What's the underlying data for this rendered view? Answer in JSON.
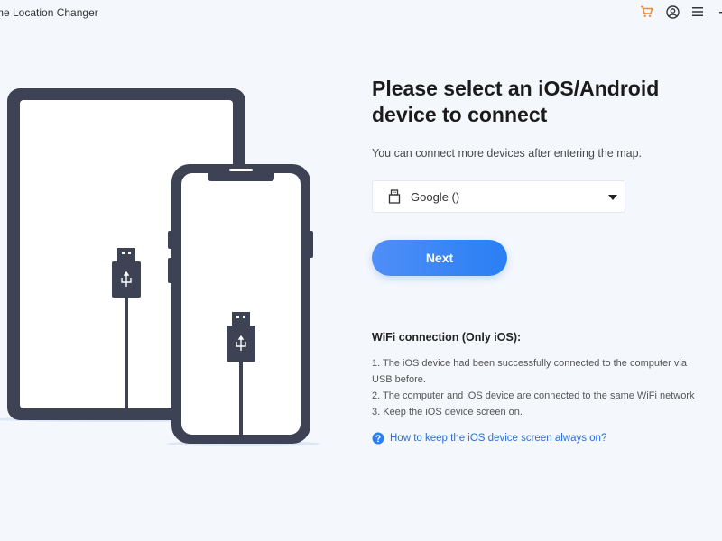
{
  "titlebar": {
    "title": "me Location Changer",
    "icons": [
      "cart-icon",
      "user-icon",
      "menu-icon",
      "minimize-icon"
    ]
  },
  "colors": {
    "accent": "#2a7ff4",
    "device_frame": "#3d4254",
    "cart_icon": "#f2892a",
    "link": "#2a6fd8"
  },
  "main": {
    "heading_line1": "Please select an iOS/Android",
    "heading_line2": "device to connect",
    "subtext": "You can connect more devices after entering the map.",
    "device_select": {
      "value": "Google ()",
      "icon": "usb-icon"
    },
    "next_label": "Next"
  },
  "wifi": {
    "title": "WiFi connection (Only iOS):",
    "lines": [
      "1. The iOS device had been successfully connected to the computer via",
      "USB before.",
      "2. The computer and iOS device are connected to the same WiFi network",
      "3. Keep the iOS device screen on."
    ],
    "help_link": "How to keep the iOS device screen always on?",
    "help_icon": "question-circle-icon"
  },
  "illustration": {
    "devices": [
      "tablet",
      "phone"
    ],
    "icons": [
      "usb-cable-icon",
      "usb-cable-icon"
    ]
  }
}
